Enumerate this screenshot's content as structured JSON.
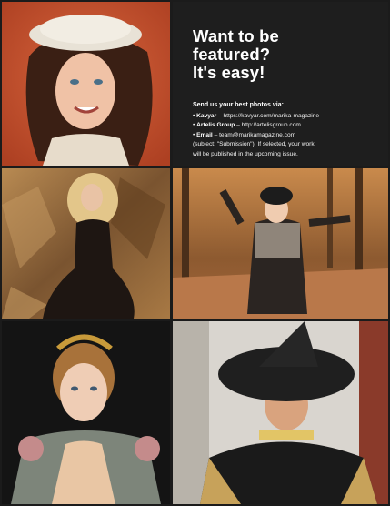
{
  "promo": {
    "headline": [
      "Want to be",
      "featured?",
      "It's easy!"
    ],
    "intro": "Send us your best photos via:",
    "items": [
      {
        "bullet": "•",
        "name": "Kavyar",
        "sep": " – ",
        "value": "https://kavyar.com/marika-magazine"
      },
      {
        "bullet": "•",
        "name": "Artelis Group",
        "sep": " – ",
        "value": "http://artelisgroup.com"
      },
      {
        "bullet": "•",
        "name": "Email",
        "sep": " – ",
        "value": "team@marikamagazine.com"
      }
    ],
    "note": [
      "(subject: \"Submission\"). If selected, your work",
      "will be published in the upcoming issue."
    ]
  },
  "colors": {
    "background": "#1b1b1b",
    "photo1_bg": "#c9502c",
    "photo3_bg": "#8a6236",
    "photo4_bg": "#a3653a",
    "photo5_bg": "#141414",
    "photo6_bg": "#d9d5cf"
  }
}
